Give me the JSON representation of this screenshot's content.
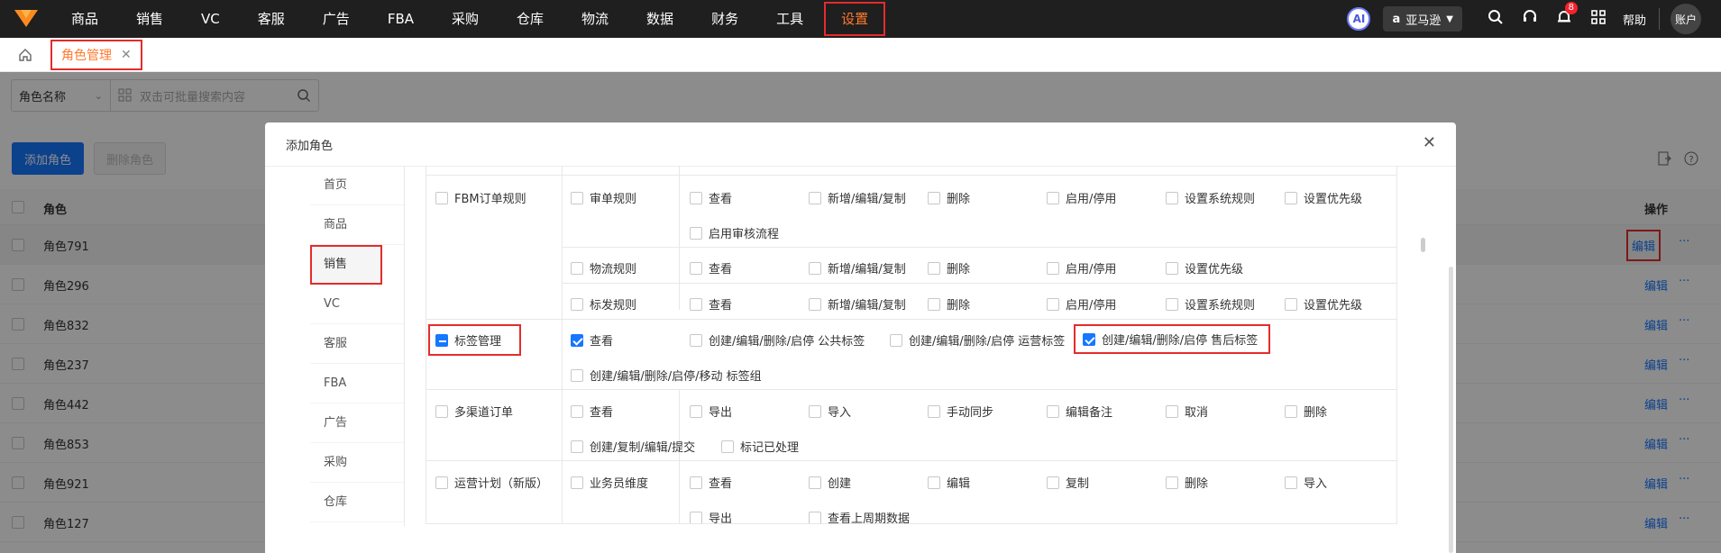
{
  "nav": {
    "items": [
      "商品",
      "销售",
      "VC",
      "客服",
      "广告",
      "FBA",
      "采购",
      "仓库",
      "物流",
      "数据",
      "财务",
      "工具",
      "设置"
    ],
    "active": "设置",
    "ai_label": "AI",
    "store_label": "亚马逊",
    "notification_count": "8",
    "help_label": "帮助",
    "account_label": "账户"
  },
  "tabs": {
    "page_tab": "角色管理",
    "close": "✕"
  },
  "search": {
    "field_label": "角色名称",
    "placeholder": "双击可批量搜索内容"
  },
  "toolbar": {
    "add_label": "添加角色",
    "delete_label": "删除角色"
  },
  "table": {
    "col_role": "角色",
    "col_action": "操作",
    "rows": [
      "角色791",
      "角色296",
      "角色832",
      "角色237",
      "角色442",
      "角色853",
      "角色921",
      "角色127"
    ],
    "edit_label": "编辑",
    "more_label": "···"
  },
  "modal": {
    "title": "添加角色",
    "close": "✕",
    "menu": [
      "首页",
      "商品",
      "销售",
      "VC",
      "客服",
      "FBA",
      "广告",
      "采购",
      "仓库"
    ],
    "active_menu": "销售",
    "perm": {
      "fbm_rules": "FBM订单规则",
      "review_rules": "审单规则",
      "view": "查看",
      "add_edit_copy": "新增/编辑/复制",
      "delete": "删除",
      "enable_disable": "启用/停用",
      "set_sys_rules": "设置系统规则",
      "set_priority": "设置优先级",
      "enable_review_flow": "启用审核流程",
      "logistics_rules": "物流规则",
      "shipping_rules": "标发规则",
      "tag_mgmt": "标签管理",
      "tag_public": "创建/编辑/删除/启停 公共标签",
      "tag_ops": "创建/编辑/删除/启停 运营标签",
      "tag_aftersale": "创建/编辑/删除/启停 售后标签",
      "tag_group": "创建/编辑/删除/启停/移动 标签组",
      "multichannel": "多渠道订单",
      "export": "导出",
      "import": "导入",
      "manual_sync": "手动同步",
      "edit_note": "编辑备注",
      "cancel": "取消",
      "create_copy_edit_submit": "创建/复制/编辑/提交",
      "mark_processed": "标记已处理",
      "ops_plan": "运营计划（新版）",
      "salesman_dim": "业务员维度",
      "create": "创建",
      "edit": "编辑",
      "copy": "复制",
      "view_last_period": "查看上周期数据"
    }
  }
}
